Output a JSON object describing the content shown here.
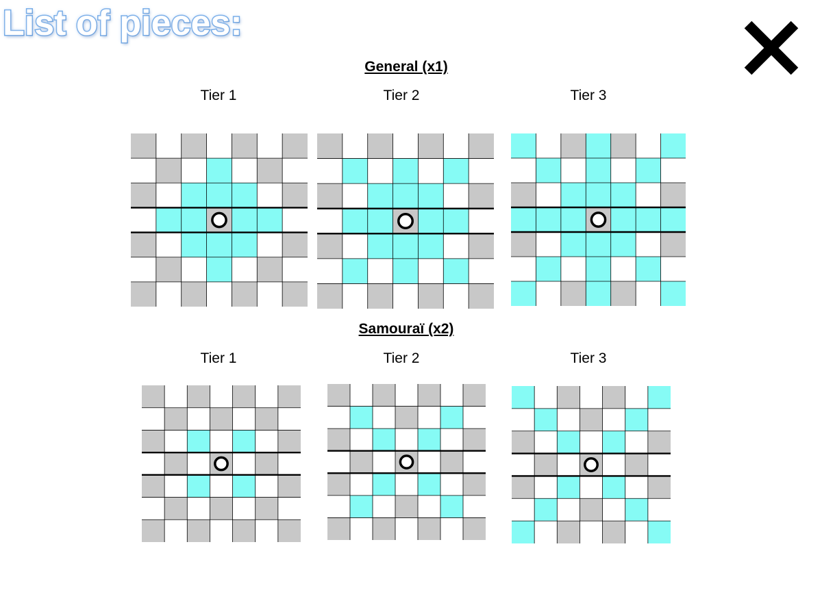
{
  "page": {
    "title": "List of pieces:"
  },
  "close_button": {
    "icon": "close-icon"
  },
  "colors": {
    "move": "#86fbf5",
    "dark": "#c8c8c8",
    "light": "#ffffff",
    "line": "#000000"
  },
  "pieces": [
    {
      "heading": "General (x1)",
      "tiers": [
        {
          "label": "Tier 1",
          "size": 7,
          "moves": [
            [
              1,
              3
            ],
            [
              2,
              2
            ],
            [
              2,
              3
            ],
            [
              2,
              4
            ],
            [
              3,
              1
            ],
            [
              3,
              2
            ],
            [
              3,
              4
            ],
            [
              3,
              5
            ],
            [
              4,
              2
            ],
            [
              4,
              3
            ],
            [
              4,
              4
            ],
            [
              5,
              3
            ]
          ]
        },
        {
          "label": "Tier 2",
          "size": 7,
          "moves": [
            [
              1,
              1
            ],
            [
              1,
              3
            ],
            [
              1,
              5
            ],
            [
              2,
              2
            ],
            [
              2,
              3
            ],
            [
              2,
              4
            ],
            [
              3,
              1
            ],
            [
              3,
              2
            ],
            [
              3,
              4
            ],
            [
              3,
              5
            ],
            [
              4,
              2
            ],
            [
              4,
              3
            ],
            [
              4,
              4
            ],
            [
              5,
              1
            ],
            [
              5,
              3
            ],
            [
              5,
              5
            ]
          ]
        },
        {
          "label": "Tier 3",
          "size": 7,
          "moves": [
            [
              0,
              0
            ],
            [
              0,
              3
            ],
            [
              0,
              6
            ],
            [
              1,
              1
            ],
            [
              1,
              3
            ],
            [
              1,
              5
            ],
            [
              2,
              2
            ],
            [
              2,
              3
            ],
            [
              2,
              4
            ],
            [
              3,
              0
            ],
            [
              3,
              1
            ],
            [
              3,
              2
            ],
            [
              3,
              4
            ],
            [
              3,
              5
            ],
            [
              3,
              6
            ],
            [
              4,
              2
            ],
            [
              4,
              3
            ],
            [
              4,
              4
            ],
            [
              5,
              1
            ],
            [
              5,
              3
            ],
            [
              5,
              5
            ],
            [
              6,
              0
            ],
            [
              6,
              3
            ],
            [
              6,
              6
            ]
          ]
        }
      ]
    },
    {
      "heading": "Samouraï (x2)",
      "tiers": [
        {
          "label": "Tier 1",
          "size": 7,
          "moves": [
            [
              2,
              2
            ],
            [
              2,
              4
            ],
            [
              4,
              2
            ],
            [
              4,
              4
            ]
          ]
        },
        {
          "label": "Tier 2",
          "size": 7,
          "moves": [
            [
              1,
              1
            ],
            [
              1,
              5
            ],
            [
              2,
              2
            ],
            [
              2,
              4
            ],
            [
              4,
              2
            ],
            [
              4,
              4
            ],
            [
              5,
              1
            ],
            [
              5,
              5
            ]
          ]
        },
        {
          "label": "Tier 3",
          "size": 7,
          "moves": [
            [
              0,
              0
            ],
            [
              0,
              6
            ],
            [
              1,
              1
            ],
            [
              1,
              5
            ],
            [
              2,
              2
            ],
            [
              2,
              4
            ],
            [
              4,
              2
            ],
            [
              4,
              4
            ],
            [
              5,
              1
            ],
            [
              5,
              5
            ],
            [
              6,
              0
            ],
            [
              6,
              6
            ]
          ]
        }
      ]
    }
  ]
}
